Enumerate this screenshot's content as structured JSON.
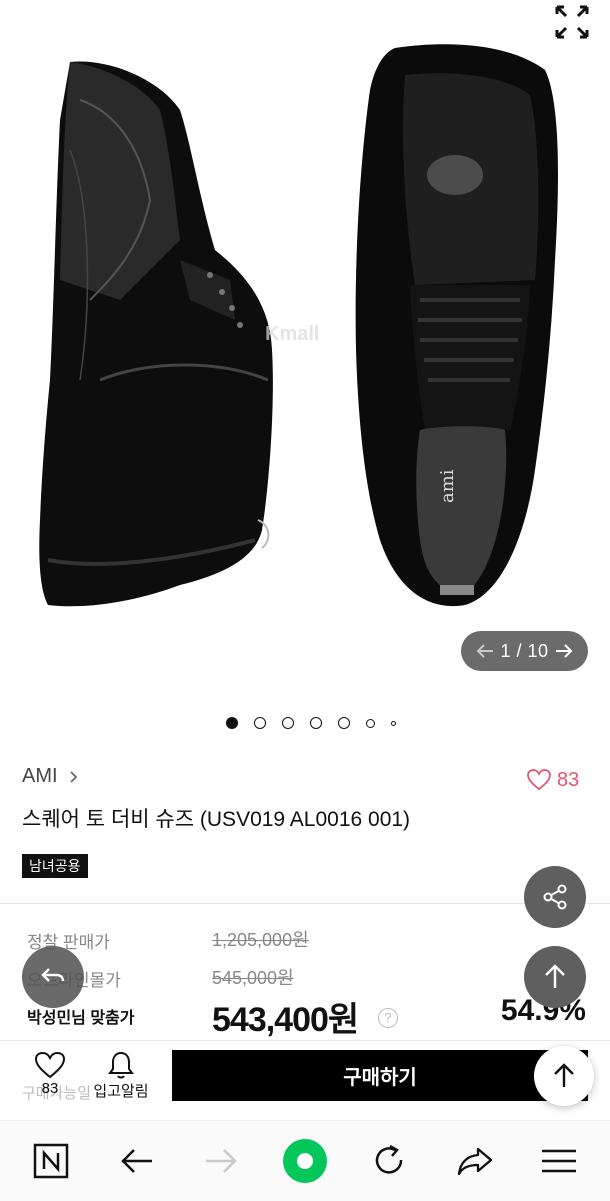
{
  "gallery": {
    "counter_current": "1",
    "counter_separator": "/",
    "counter_total": "10",
    "insole_brand": "ami",
    "watermark": "Kmall"
  },
  "product": {
    "brand": "AMI",
    "like_count": "83",
    "title": "스퀘어 토 더비 슈즈 (USV019 AL0016 001)",
    "tag": "남녀공용"
  },
  "prices": {
    "list_label": "정찰 판매가",
    "list_price": "1,205,000원",
    "offline_label": "오프라인몰가",
    "offline_price": "545,000원",
    "member_label": "박성민님 맞춤가",
    "member_price": "543,400원",
    "help": "?",
    "discount": "54.9%"
  },
  "bottom": {
    "like_count": "83",
    "restock_label": "입고알림",
    "buy_label": "구매하기",
    "ghost_text": "구매가능일"
  },
  "colors": {
    "accent_pink": "#e3566f",
    "buy_button": "#000000",
    "fab_gray": "#5f5f5f",
    "browser_green": "#03c75a"
  }
}
